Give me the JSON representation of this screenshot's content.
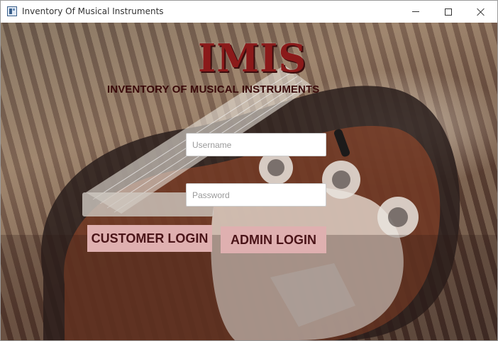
{
  "window": {
    "title": "Inventory Of Musical Instruments",
    "icon": "java-app-icon"
  },
  "header": {
    "logo": "IMIS",
    "subtitle": "INVENTORY OF MUSICAL INSTRUMENTS"
  },
  "form": {
    "username_placeholder": "Username",
    "username_value": "",
    "password_placeholder": "Password",
    "password_value": ""
  },
  "buttons": {
    "customer_login": "CUSTOMER LOGIN",
    "admin_login": "ADMIN LOGIN"
  },
  "colors": {
    "logo": "#8b1a1a",
    "subtitle": "#3a0a0a",
    "button_bg": "#dfb0b0",
    "button_text": "#4a1418"
  }
}
